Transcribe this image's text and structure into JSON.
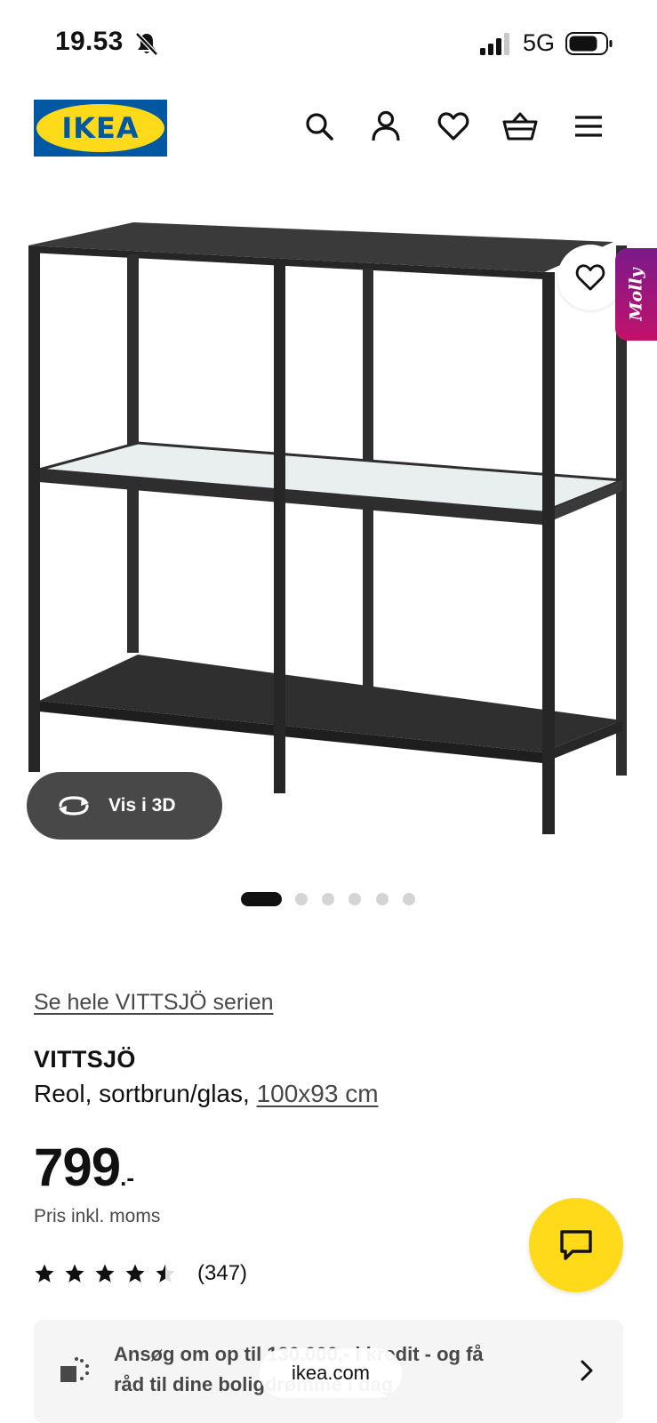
{
  "status_bar": {
    "time": "19.53",
    "network": "5G",
    "icons": [
      "bell-slash-icon",
      "signal-icon",
      "battery-icon"
    ]
  },
  "header": {
    "logo_text": "IKEA",
    "icons": [
      "search-icon",
      "account-icon",
      "heart-icon",
      "basket-icon",
      "menu-icon"
    ]
  },
  "gallery": {
    "image_count": 6,
    "active_index": 0,
    "view_3d_label": "Vis i 3D",
    "assistant_tab_label": "Molly"
  },
  "product": {
    "series_link": "Se hele VITTSJÖ serien",
    "name": "VITTSJÖ",
    "description": "Reol, sortbrun/glas,",
    "size_link": "100x93 cm",
    "price_integer": "799",
    "price_suffix": ".-",
    "price_note": "Pris inkl. moms",
    "rating_value": 4.5,
    "rating_max": 5,
    "review_count": "(347)"
  },
  "credit_banner": {
    "line_1": "Ansøg om op til 130.000,- i kredit - og få",
    "line_2": "råd til dine boligdrømme i dag"
  },
  "browser": {
    "url": "ikea.com"
  },
  "colors": {
    "ikea_blue": "#0058a3",
    "ikea_yellow": "#ffda1a",
    "text_dark": "#111111",
    "text_muted": "#484848",
    "molly_gradient_start": "#7a1a8a",
    "molly_gradient_end": "#c2126a"
  }
}
